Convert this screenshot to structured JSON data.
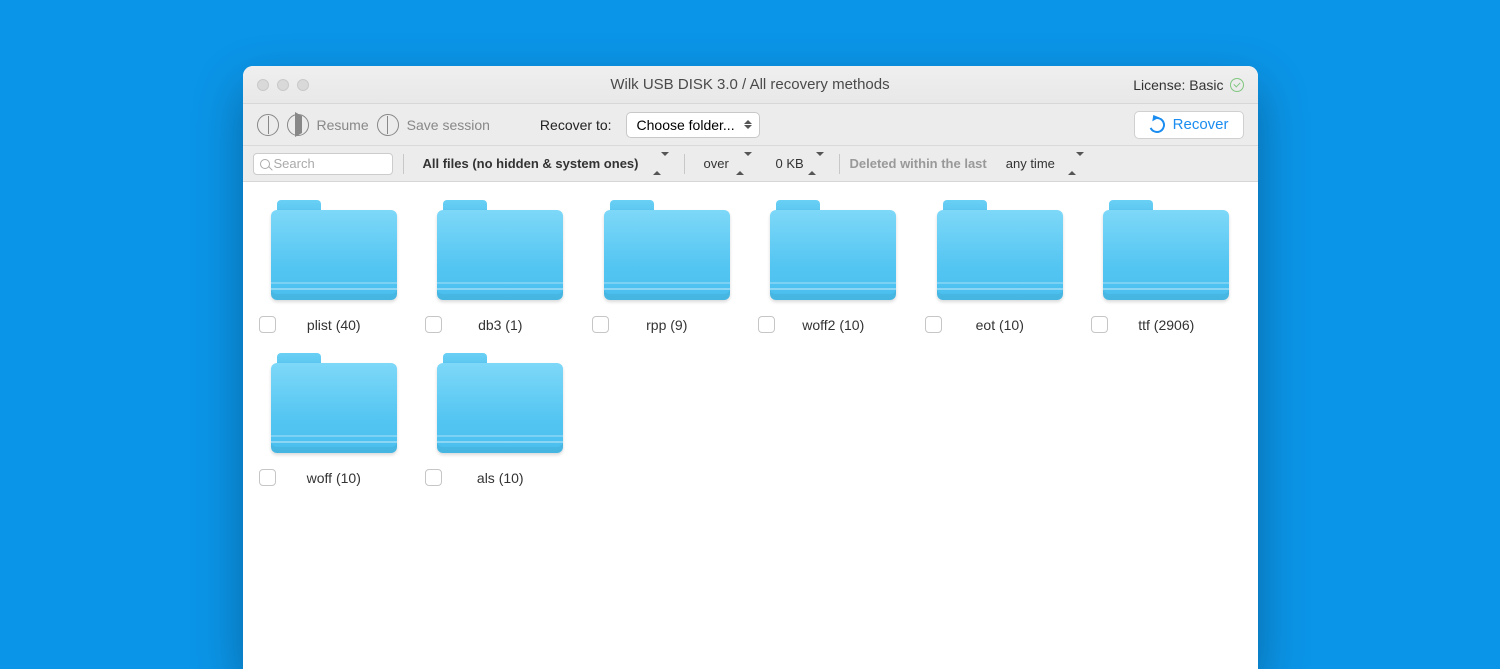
{
  "titlebar": {
    "title": "Wilk USB DISK 3.0 / All recovery methods",
    "license_label": "License: Basic"
  },
  "toolbar1": {
    "resume_label": "Resume",
    "save_session_label": "Save session",
    "recover_to_label": "Recover to:",
    "recover_to_value": "Choose folder...",
    "recover_button": "Recover"
  },
  "toolbar2": {
    "search_placeholder": "Search",
    "file_filter": "All files (no hidden & system ones)",
    "size_op": "over",
    "size_value": "0 KB",
    "deleted_label": "Deleted within the last",
    "deleted_value": "any time"
  },
  "folders": [
    {
      "label": "plist (40)"
    },
    {
      "label": "db3 (1)"
    },
    {
      "label": "rpp (9)"
    },
    {
      "label": "woff2 (10)"
    },
    {
      "label": "eot (10)"
    },
    {
      "label": "ttf (2906)"
    },
    {
      "label": "woff (10)"
    },
    {
      "label": "als (10)"
    }
  ]
}
